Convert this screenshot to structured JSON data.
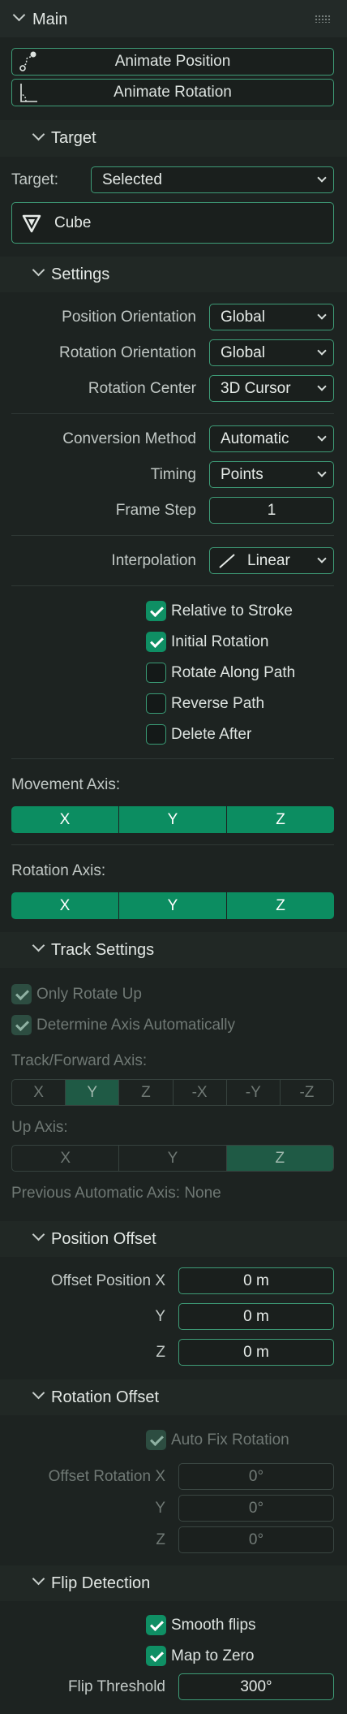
{
  "main": {
    "title": "Main",
    "animate_position": "Animate Position",
    "animate_rotation": "Animate Rotation"
  },
  "target": {
    "header": "Target",
    "label": "Target:",
    "value": "Selected",
    "object": "Cube"
  },
  "settings": {
    "header": "Settings",
    "position_orientation": {
      "label": "Position Orientation",
      "value": "Global"
    },
    "rotation_orientation": {
      "label": "Rotation Orientation",
      "value": "Global"
    },
    "rotation_center": {
      "label": "Rotation Center",
      "value": "3D Cursor"
    },
    "conversion_method": {
      "label": "Conversion Method",
      "value": "Automatic"
    },
    "timing": {
      "label": "Timing",
      "value": "Points"
    },
    "frame_step": {
      "label": "Frame Step",
      "value": "1"
    },
    "interpolation": {
      "label": "Interpolation",
      "value": "Linear"
    },
    "relative_to_stroke": {
      "label": "Relative to Stroke",
      "checked": true
    },
    "initial_rotation": {
      "label": "Initial Rotation",
      "checked": true
    },
    "rotate_along_path": {
      "label": "Rotate Along Path",
      "checked": false
    },
    "reverse_path": {
      "label": "Reverse Path",
      "checked": false
    },
    "delete_after": {
      "label": "Delete After",
      "checked": false
    },
    "movement_axis": {
      "label": "Movement Axis:",
      "options": [
        "X",
        "Y",
        "Z"
      ]
    },
    "rotation_axis": {
      "label": "Rotation Axis:",
      "options": [
        "X",
        "Y",
        "Z"
      ]
    }
  },
  "track": {
    "header": "Track Settings",
    "only_rotate_up": "Only Rotate Up",
    "determine_axis": "Determine Axis Automatically",
    "forward_label": "Track/Forward Axis:",
    "forward_options": [
      "X",
      "Y",
      "Z",
      "-X",
      "-Y",
      "-Z"
    ],
    "forward_selected": "Y",
    "up_label": "Up Axis:",
    "up_options": [
      "X",
      "Y",
      "Z"
    ],
    "up_selected": "Z",
    "previous": "Previous Automatic Axis: None"
  },
  "position_offset": {
    "header": "Position Offset",
    "label_x": "Offset Position X",
    "label_y": "Y",
    "label_z": "Z",
    "x": "0 m",
    "y": "0 m",
    "z": "0 m"
  },
  "rotation_offset": {
    "header": "Rotation Offset",
    "auto_fix": "Auto Fix Rotation",
    "label_x": "Offset Rotation X",
    "label_y": "Y",
    "label_z": "Z",
    "x": "0°",
    "y": "0°",
    "z": "0°"
  },
  "flip": {
    "header": "Flip Detection",
    "smooth_flips": "Smooth flips",
    "map_to_zero": "Map to Zero",
    "threshold_label": "Flip Threshold",
    "threshold": "300°"
  },
  "colors": {
    "accent": "#0c8d61",
    "background": "#1d2321",
    "border": "#3e9c77"
  }
}
